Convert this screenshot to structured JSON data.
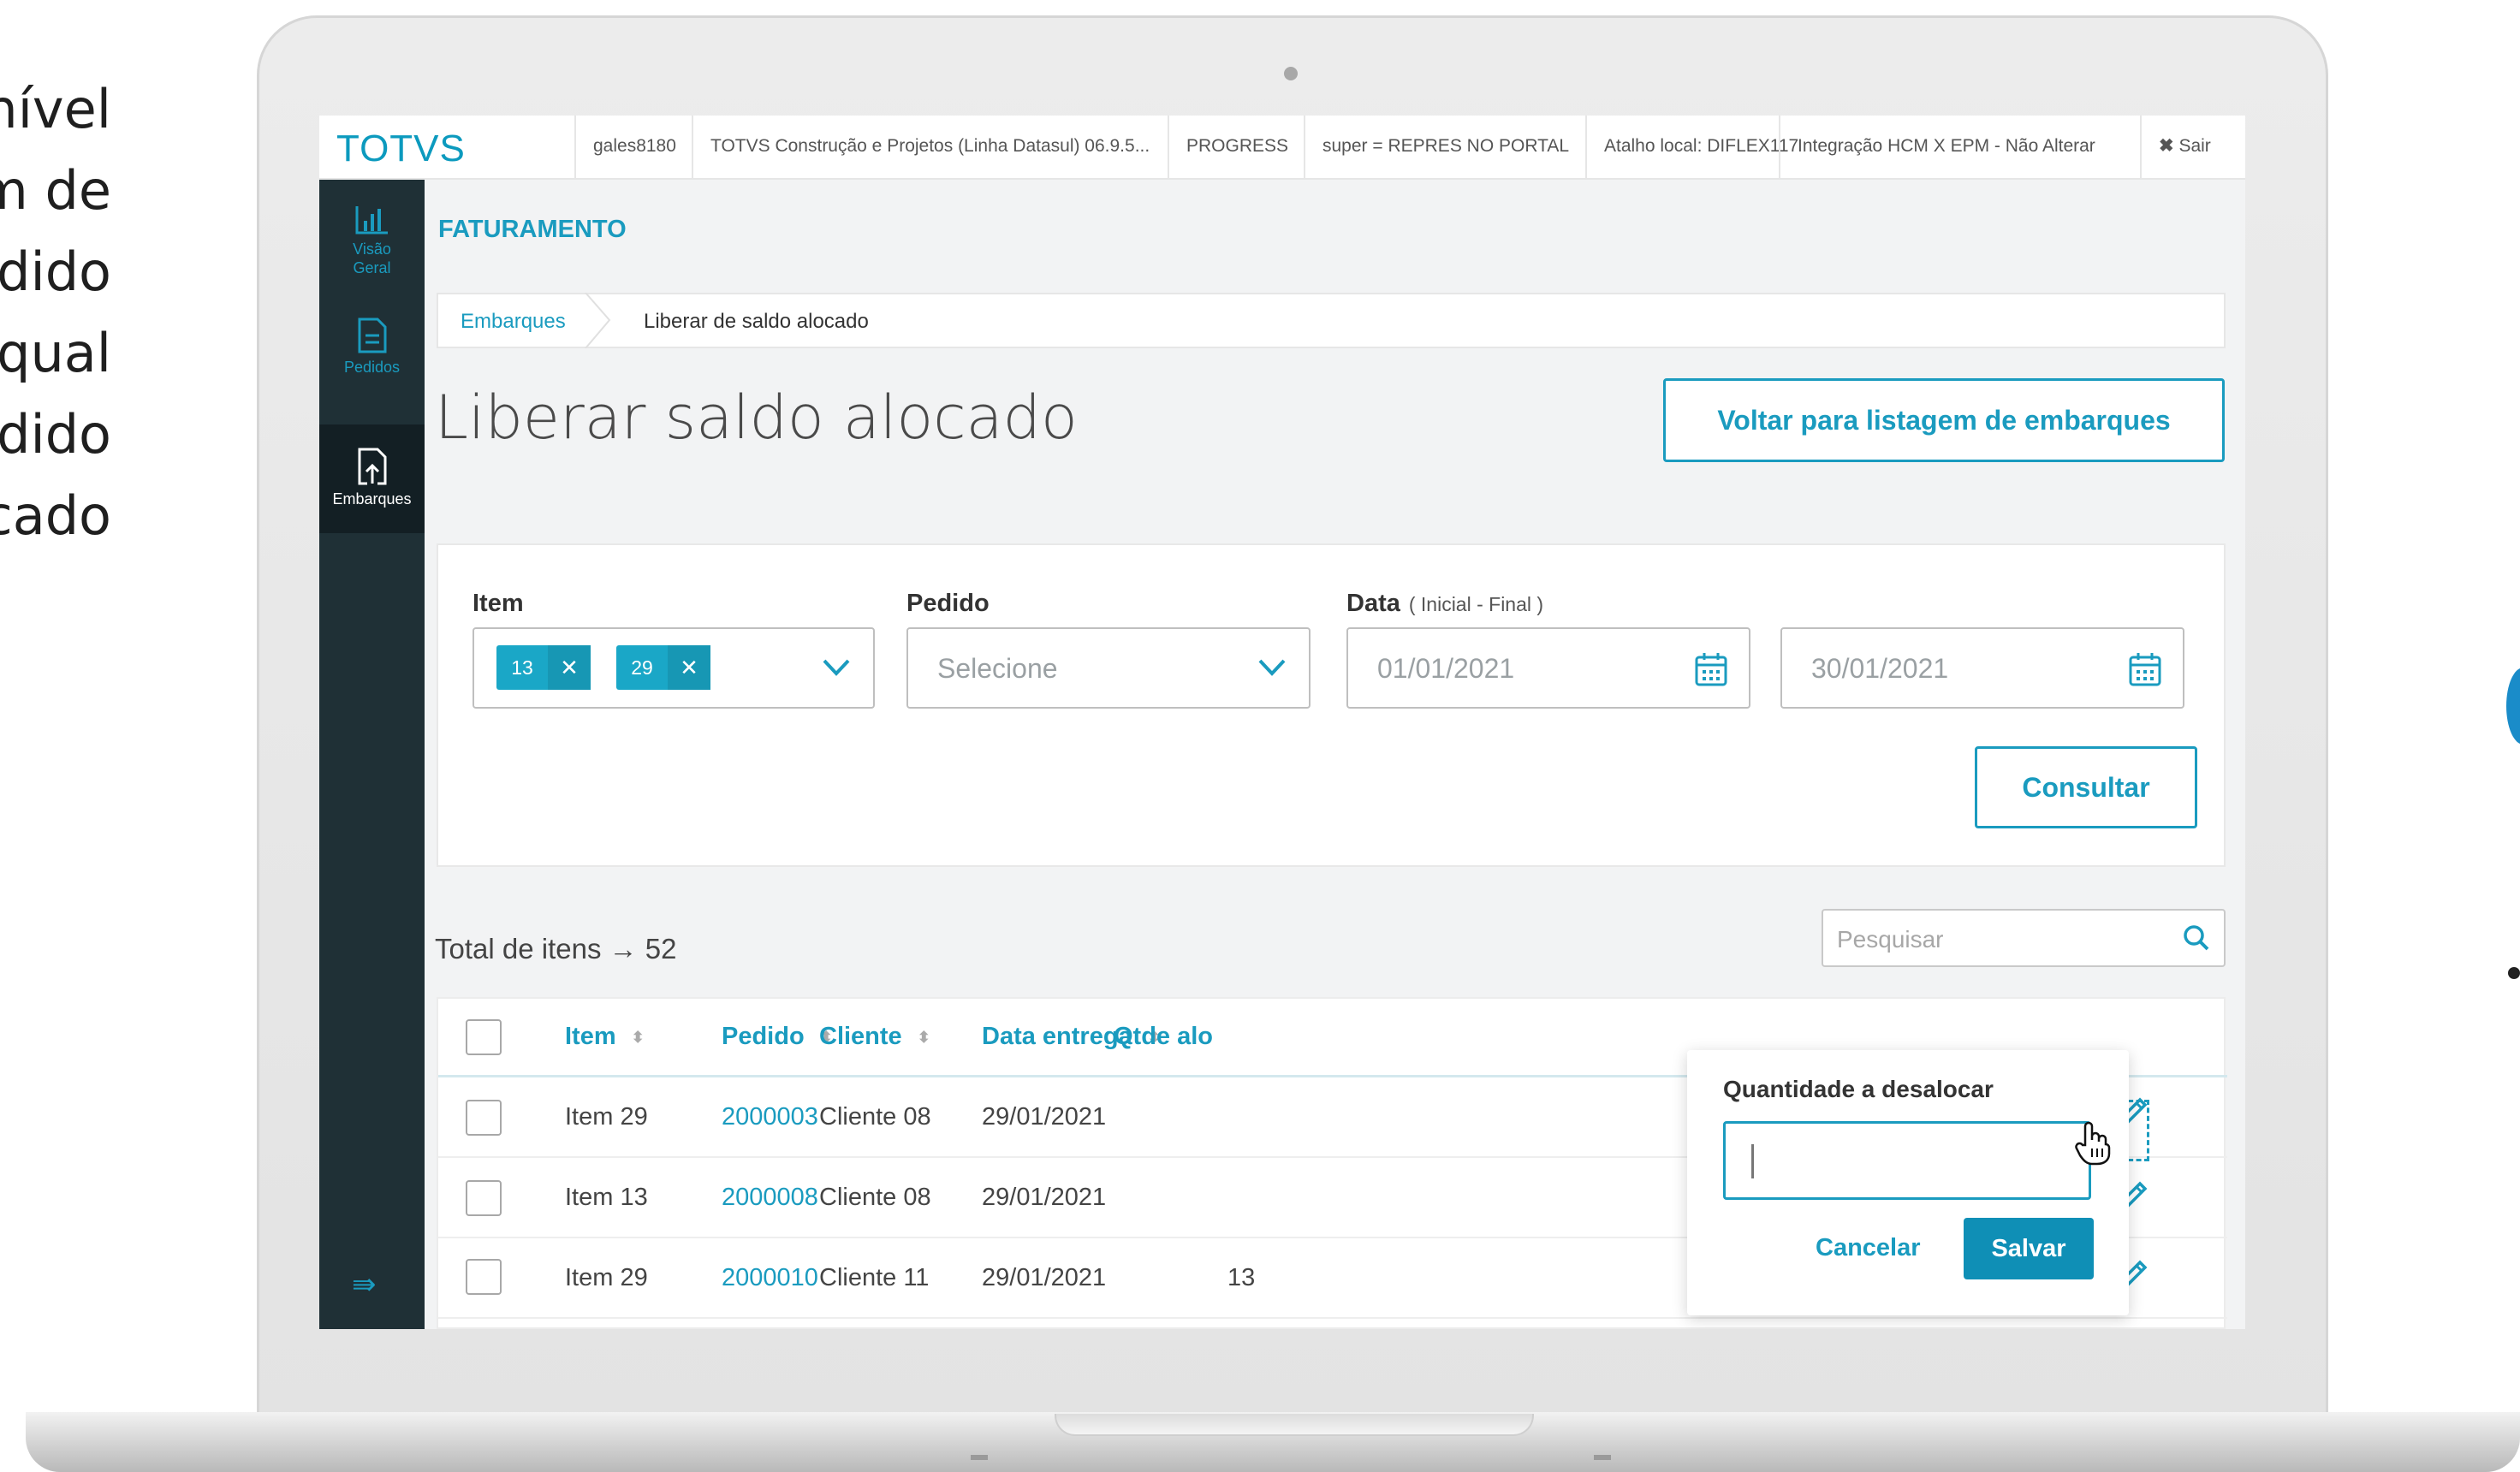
{
  "slide_text": [
    "nível",
    "m de",
    "dido",
    "qual",
    "dido",
    "cado"
  ],
  "topbar": {
    "logo": "TOTVS",
    "items": [
      "gales8180",
      "TOTVS Construção e Projetos (Linha Datasul) 06.9.5...",
      "PROGRESS",
      "super = REPRES NO PORTAL",
      "Atalho local: DIFLEX117",
      "Integração HCM X EPM - Não Alterar"
    ],
    "logout": "Sair"
  },
  "sidebar": {
    "items": [
      {
        "label_1": "Visão",
        "label_2": "Geral",
        "icon": "bar-chart-icon"
      },
      {
        "label_1": "Pedidos",
        "icon": "document-icon"
      },
      {
        "label_1": "Embarques",
        "icon": "upload-file-icon",
        "active": true
      }
    ],
    "toggle_icon": "collapse-menu-icon"
  },
  "module_title": "FATURAMENTO",
  "breadcrumb": {
    "link": "Embarques",
    "current": "Liberar de saldo alocado"
  },
  "page": {
    "title": "Liberar saldo alocado",
    "back_button": "Voltar para listagem de embarques"
  },
  "filters": {
    "item": {
      "label": "Item",
      "chips": [
        "13",
        "29"
      ]
    },
    "pedido": {
      "label": "Pedido",
      "placeholder": "Selecione"
    },
    "data": {
      "label": "Data",
      "sublabel": "( Inicial - Final )",
      "start": "01/01/2021",
      "end": "30/01/2021"
    },
    "consult_button": "Consultar"
  },
  "total_label": "Total de itens → 52",
  "search_placeholder": "Pesquisar",
  "table": {
    "headers": [
      "Item",
      "Pedido",
      "Cliente",
      "Data entrega",
      "Qtde alo"
    ],
    "rows": [
      {
        "item": "Item 29",
        "pedido": "2000003",
        "cliente": "Cliente 08",
        "data": "29/01/2021",
        "qtde": "",
        "saldo": ""
      },
      {
        "item": "Item 13",
        "pedido": "2000008",
        "cliente": "Cliente 08",
        "data": "29/01/2021",
        "qtde": "",
        "saldo": ""
      },
      {
        "item": "Item 29",
        "pedido": "2000010",
        "cliente": "Cliente 11",
        "data": "29/01/2021",
        "qtde": "13",
        "saldo": "---"
      }
    ]
  },
  "popover": {
    "title": "Quantidade a desalocar",
    "input_value": "",
    "cancel": "Cancelar",
    "save": "Salvar"
  },
  "colors": {
    "accent": "#1a9bbf",
    "sidebar": "#1f3036",
    "button_primary": "#0f8fb6"
  }
}
